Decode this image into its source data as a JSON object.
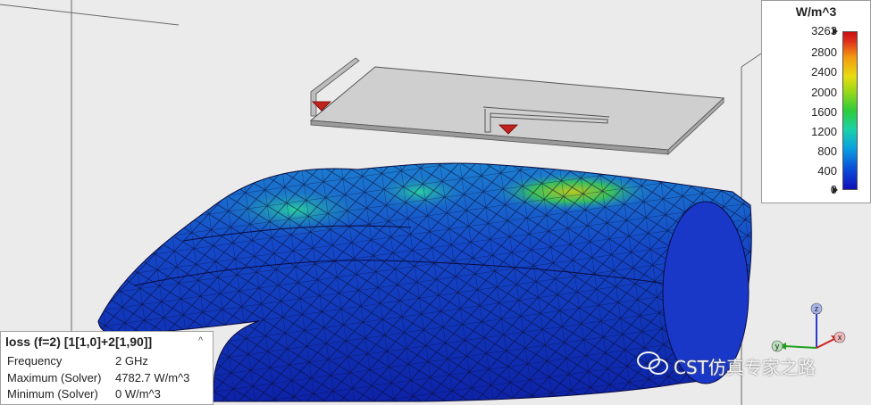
{
  "legend": {
    "unit": "W/m^3",
    "ticks": [
      "3263",
      "2800",
      "2400",
      "2000",
      "1600",
      "1200",
      "800",
      "400",
      "0"
    ]
  },
  "info_panel": {
    "title": "loss (f=2) [1[1,0]+2[1,90]]",
    "rows": [
      {
        "label": "Frequency",
        "value": "2 GHz"
      },
      {
        "label": "Maximum (Solver)",
        "value": "4782.7 W/m^3"
      },
      {
        "label": "Minimum (Solver)",
        "value": "0 W/m^3"
      }
    ]
  },
  "axes": {
    "x": "x",
    "y": "y",
    "z": "z"
  },
  "watermark": {
    "text": "CST仿真专家之路"
  },
  "colors": {
    "background": "#e9e9e9",
    "board": "#c8c8c8",
    "port": "#c0231c",
    "mesh_low": "#1838c8",
    "mesh_mid": "#1ab8a0",
    "mesh_high": "#c8c818"
  },
  "icons": {
    "collapse": "chevron-up-icon",
    "wechat": "wechat-icon"
  }
}
